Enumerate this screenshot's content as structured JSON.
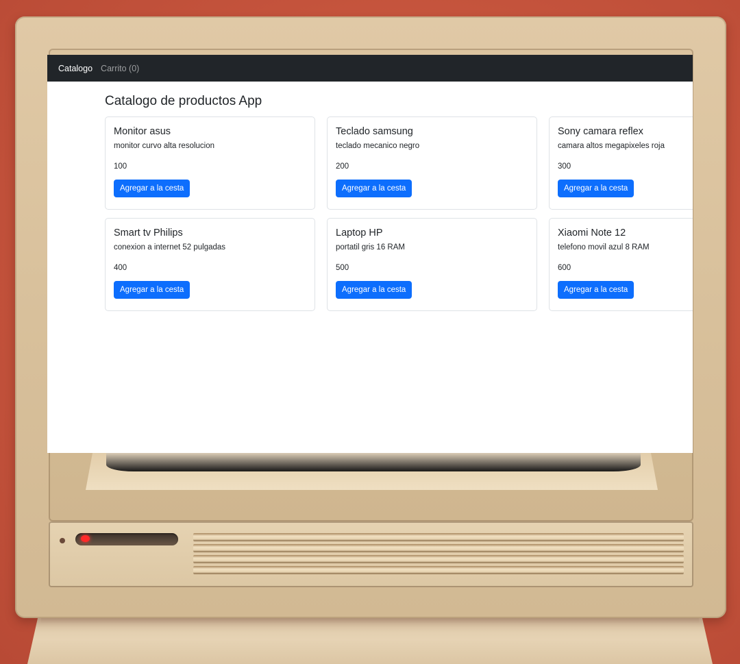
{
  "nav": {
    "brand": "Catalogo",
    "cart_link": "Carrito (0)"
  },
  "page": {
    "title": "Catalogo de productos App"
  },
  "products": [
    {
      "name": "Monitor asus",
      "description": "monitor curvo alta resolucion",
      "price": "100",
      "button": "Agregar a la cesta"
    },
    {
      "name": "Teclado samsung",
      "description": "teclado mecanico negro",
      "price": "200",
      "button": "Agregar a la cesta"
    },
    {
      "name": "Sony camara reflex",
      "description": "camara altos megapixeles roja",
      "price": "300",
      "button": "Agregar a la cesta"
    },
    {
      "name": "Smart tv Philips",
      "description": "conexion a internet 52 pulgadas",
      "price": "400",
      "button": "Agregar a la cesta"
    },
    {
      "name": "Laptop HP",
      "description": "portatil gris 16 RAM",
      "price": "500",
      "button": "Agregar a la cesta"
    },
    {
      "name": "Xiaomi Note 12",
      "description": "telefono movil azul 8 RAM",
      "price": "600",
      "button": "Agregar a la cesta"
    }
  ],
  "colors": {
    "navbar": "#212529",
    "primary_button": "#0d6efd",
    "background": "#c4533c",
    "power_led": "#ff2a2a"
  }
}
